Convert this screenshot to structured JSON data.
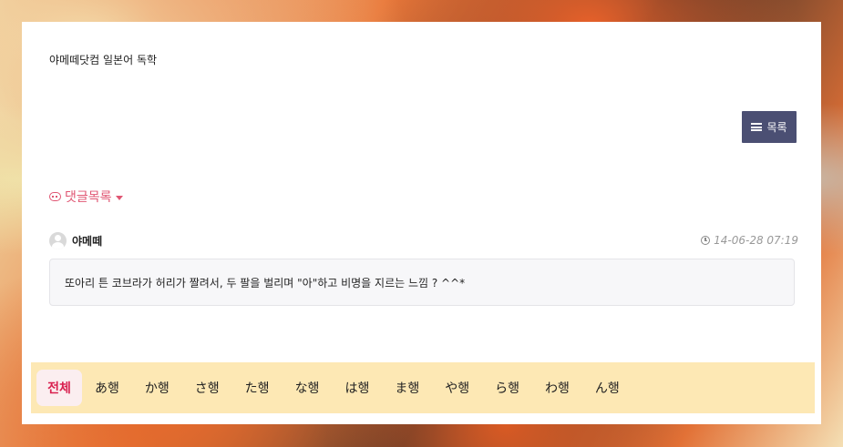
{
  "site": {
    "title": "야메떼닷컴 일본어 독학"
  },
  "toolbar": {
    "list_label": "목록"
  },
  "comments": {
    "toggle_label": "댓글목록",
    "items": [
      {
        "author": "야메떼",
        "date": "14-06-28 07:19",
        "body": "또아리 튼 코브라가 허리가 짤려서, 두 팔을 벌리며 \"아\"하고 비명을 지르는 느낌 ? ^^*"
      }
    ]
  },
  "kana_nav": {
    "tabs": [
      "전체",
      "あ행",
      "か행",
      "さ행",
      "た행",
      "な행",
      "は행",
      "ま행",
      "や행",
      "ら행",
      "わ행",
      "ん행"
    ],
    "active": "전체"
  },
  "colors": {
    "accent": "#e05673",
    "button_bg": "#4b4f73",
    "nav_bg": "#fde8b4",
    "active_tab_text": "#d9204f"
  }
}
